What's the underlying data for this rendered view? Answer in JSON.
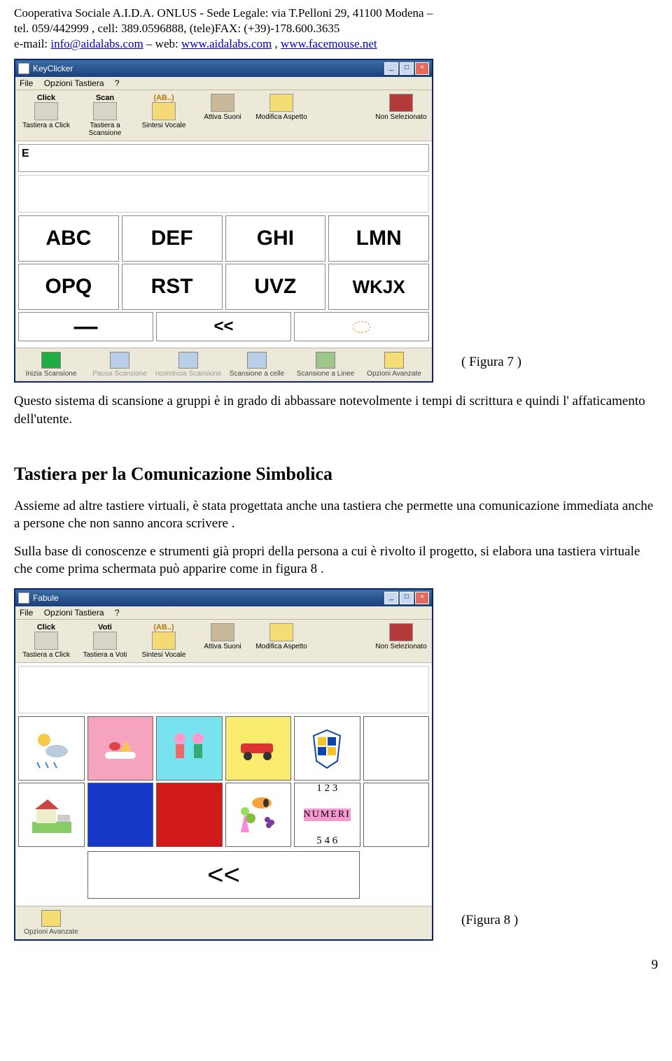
{
  "header": {
    "line1": "Cooperativa Sociale A.I.D.A. ONLUS  - Sede Legale: via T.Pelloni 29, 41100  Modena –",
    "line2": "tel. 059/442999 ,  cell: 389.0596888, (tele)FAX: (+39)-178.600.3635",
    "line3_prefix": "e-mail: ",
    "email": "info@aidalabs.com",
    "line3_mid": " – web: ",
    "web1": "www.aidalabs.com",
    "sep": " , ",
    "web2": "www.facemouse.net"
  },
  "fig7": {
    "caption": "( Figura 7 )",
    "title": "KeyClicker",
    "menu": [
      "File",
      "Opzioni Tastiera",
      "?"
    ],
    "toolbar": [
      {
        "top": "Click",
        "label": "Tastiera a Click"
      },
      {
        "top": "Scan",
        "label": "Tastiera a Scansione"
      },
      {
        "top": "(AB..)",
        "label": "Sintesi Vocale"
      },
      {
        "top": "",
        "label": "Attiva Suoni"
      },
      {
        "top": "",
        "label": "Modifica Aspetto"
      }
    ],
    "toolbar_right": {
      "label": "Non Selezionato"
    },
    "typed": "E",
    "row1": [
      "ABC",
      "DEF",
      "GHI",
      "LMN"
    ],
    "row2": [
      "OPQ",
      "RST",
      "UVZ",
      "WKJX"
    ],
    "row3": [
      "—",
      "<<",
      ""
    ],
    "bottom": [
      "Inizia Scansione",
      "Pausa Scansione",
      "ricomincia Scansione",
      "Scansione a celle",
      "Scansione a Linee",
      "Opzioni Avanzate"
    ]
  },
  "para1": "Questo sistema  di scansione a gruppi è in grado di abbassare notevolmente i tempi di scrittura e quindi l' affaticamento dell'utente.",
  "section_heading": "Tastiera per la Comunicazione Simbolica",
  "para2": "Assieme ad altre tastiere virtuali, è stata progettata anche una tastiera che permette una comunicazione immediata anche a  persone che non sanno ancora scrivere .",
  "para3": "Sulla base di conoscenze e strumenti già propri della  persona a cui è rivolto il progetto, si  elabora una tastiera virtuale che come prima schermata può apparire come in figura  8 .",
  "fig8": {
    "caption": "(Figura 8 )",
    "title": "Fabule",
    "menu": [
      "File",
      "Opzioni Tastiera",
      "?"
    ],
    "toolbar": [
      {
        "top": "Click",
        "label": "Tastiera a Click"
      },
      {
        "top": "Voti",
        "label": "Tastiera a Voti"
      },
      {
        "top": "(AB..)",
        "label": "Sintesi Vocale"
      },
      {
        "top": "",
        "label": "Attiva Suoni"
      },
      {
        "top": "",
        "label": "Modifica Aspetto"
      }
    ],
    "toolbar_right": {
      "label": "Non Selezionato"
    },
    "numeri_top": "1 2 3",
    "numeri_mid": "NUMERI",
    "numeri_bot": "5 4 6",
    "back_label": "<<",
    "bottom": [
      "Opzioni Avanzate"
    ]
  },
  "page_number": "9"
}
